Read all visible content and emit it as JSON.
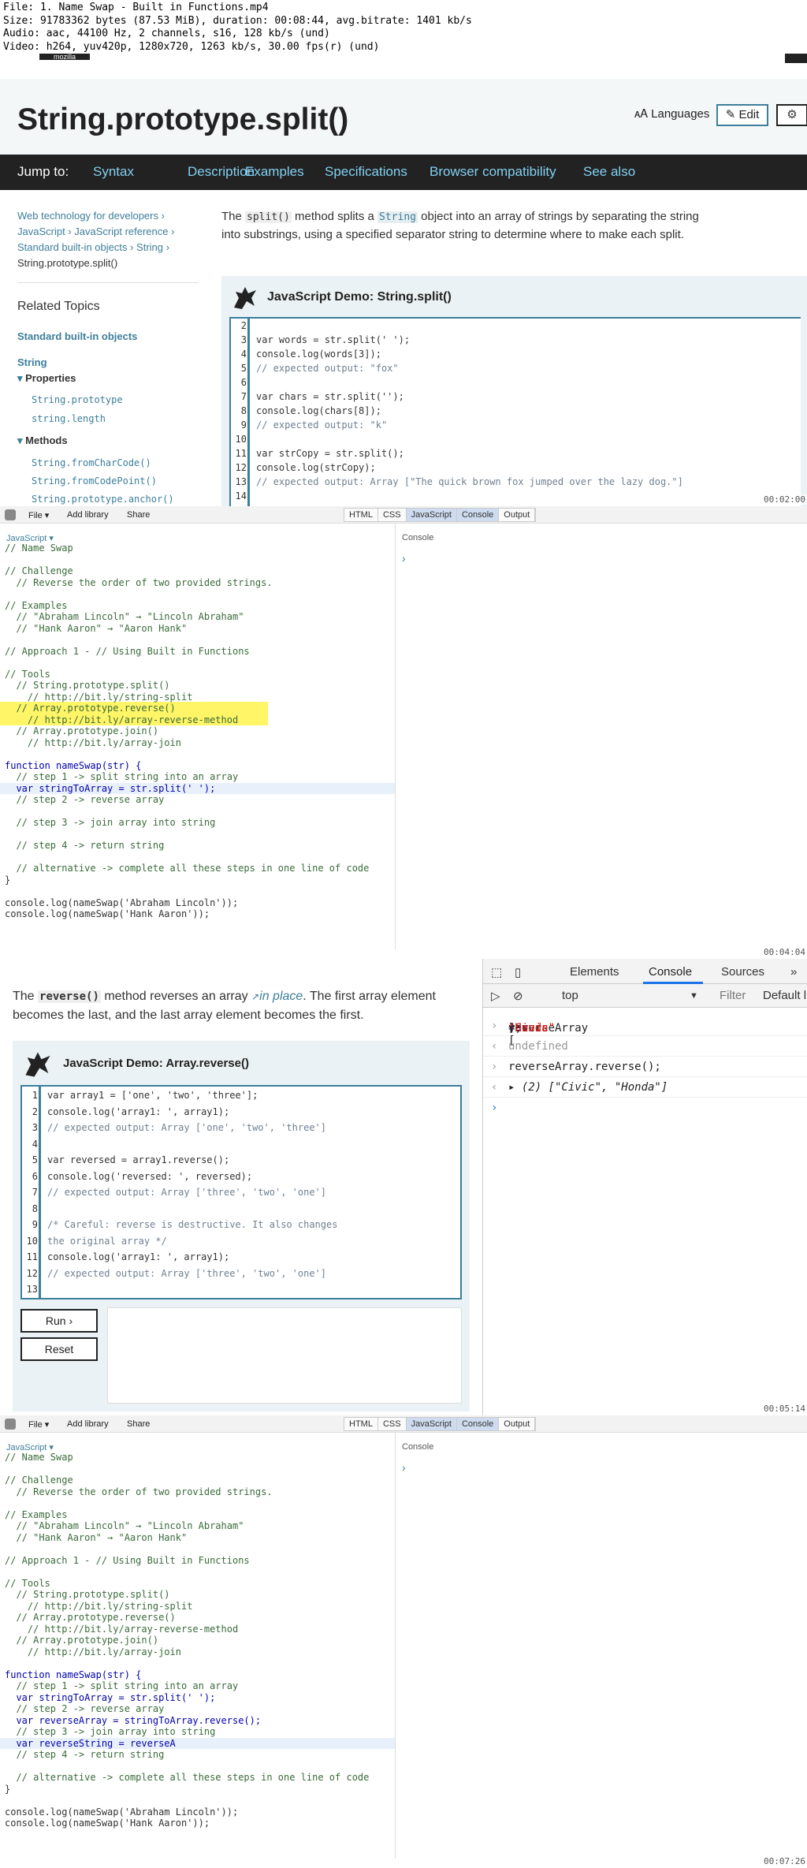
{
  "fileinfo": {
    "line1": "File: 1. Name Swap - Built in Functions.mp4",
    "line2": "Size: 91783362 bytes (87.53 MiB), duration: 00:08:44, avg.bitrate: 1401 kb/s",
    "line3": "Audio: aac, 44100 Hz, 2 channels, s16, 128 kb/s (und)",
    "line4": "Video: h264, yuv420p, 1280x720, 1263 kb/s, 30.00 fps(r) (und)"
  },
  "frame1": {
    "logo": "mozilla",
    "title": "String.prototype.split()",
    "languages": "Languages",
    "edit": "Edit",
    "gear": "⚙",
    "jump_to": "Jump to:",
    "jump_links": [
      "Syntax",
      "Description",
      "Examples",
      "Specifications",
      "Browser compatibility",
      "See also"
    ],
    "breadcrumbs": [
      "Web technology for developers ›",
      "JavaScript ›",
      "JavaScript reference ›",
      "Standard built-in objects ›",
      "String ›",
      "String.prototype.split()"
    ],
    "related_topics": "Related Topics",
    "std_objects": "Standard built-in objects",
    "string": "String",
    "properties": "Properties",
    "prop_items": [
      "String.prototype",
      "string.length"
    ],
    "methods": "Methods",
    "method_items": [
      "String.fromCharCode()",
      "String.fromCodePoint()",
      "String.prototype.anchor()"
    ],
    "intro_a": "The ",
    "intro_code": "split()",
    "intro_b": " method splits a ",
    "intro_link": "String",
    "intro_c": " object into an array of strings by separating the string into substrings, using a specified separator string to determine where to make each split.",
    "demo_title": "JavaScript Demo: String.split()",
    "line_numbers": [
      "2",
      "3",
      "4",
      "5",
      "6",
      "7",
      "8",
      "9",
      "10",
      "11",
      "12",
      "13",
      "14"
    ],
    "code_lines": [
      "",
      "var words = str.split(' ');",
      "console.log(words[3]);",
      "// expected output: \"fox\"",
      "",
      "var chars = str.split('');",
      "console.log(chars[8]);",
      "// expected output: \"k\"",
      "",
      "var strCopy = str.split();",
      "console.log(strCopy);",
      "// expected output: Array [\"The quick brown fox jumped over the lazy dog.\"]",
      ""
    ],
    "timestamp": "00:02:00"
  },
  "fiddle": {
    "file": "File ▾",
    "add_library": "Add library",
    "share": "Share",
    "tabs": [
      "HTML",
      "CSS",
      "JavaScript",
      "Console",
      "Output"
    ],
    "lang": "JavaScript ▾",
    "console": "Console",
    "prompt": "›"
  },
  "frame2": {
    "lines": [
      "// Name Swap",
      "",
      "// Challenge",
      "  // Reverse the order of two provided strings.",
      "",
      "// Examples",
      "  // \"Abraham Lincoln\" → \"Lincoln Abraham\"",
      "  // \"Hank Aaron\" → \"Aaron Hank\"",
      "",
      "// Approach 1 - // Using Built in Functions",
      "",
      "// Tools",
      "  // String.prototype.split()",
      "    // http://bit.ly/string-split",
      "  // Array.prototype.reverse()",
      "    // http://bit.ly/array-reverse-method",
      "  // Array.prototype.join()",
      "    // http://bit.ly/array-join",
      "",
      "function nameSwap(str) {",
      "  // step 1 -> split string into an array",
      "  var stringToArray = str.split(' ');",
      "  // step 2 -> reverse array",
      "",
      "  // step 3 -> join array into string",
      "",
      "  // step 4 -> return string",
      "",
      "  // alternative -> complete all these steps in one line of code",
      "}",
      "",
      "console.log(nameSwap('Abraham Lincoln'));",
      "console.log(nameSwap('Hank Aaron'));"
    ],
    "timestamp": "00:04:04"
  },
  "frame3": {
    "text_a": "The ",
    "text_code": "reverse()",
    "text_b": " method reverses an array ",
    "text_em": "in place",
    "text_c": ". The first array element becomes the last, and the last array element becomes the first.",
    "demo_title": "JavaScript Demo: Array.reverse()",
    "line_numbers": [
      "1",
      "2",
      "3",
      "4",
      "5",
      "6",
      "7",
      "8",
      "9",
      "10",
      "11",
      "12",
      "13"
    ],
    "code_lines": [
      "var array1 = ['one', 'two', 'three'];",
      "console.log('array1: ', array1);",
      "// expected output: Array ['one', 'two', 'three']",
      "",
      "var reversed = array1.reverse();",
      "console.log('reversed: ', reversed);",
      "// expected output: Array ['three', 'two', 'one']",
      "",
      "/* Careful: reverse is destructive. It also changes",
      "the original array */",
      "console.log('array1: ', array1);",
      "// expected output: Array ['three', 'two', 'one']",
      ""
    ],
    "run": "Run ›",
    "reset": "Reset",
    "dev_tabs": [
      "Elements",
      "Console",
      "Sources"
    ],
    "more": "»",
    "top": "top",
    "filter": "Filter",
    "default": "Default l",
    "c1_kw": "var",
    "c1_name": "reverseArray",
    "c1_eq": " = [",
    "c1_s1": "\"Honda\"",
    "c1_comma": ", ",
    "c1_s2": "\"Civic\"",
    "c1_end": "];",
    "c2": "undefined",
    "c3": "reverseArray.reverse();",
    "c4": "▸ (2) [\"Civic\", \"Honda\"]",
    "timestamp": "00:05:14"
  },
  "frame4": {
    "lines": [
      "// Name Swap",
      "",
      "// Challenge",
      "  // Reverse the order of two provided strings.",
      "",
      "// Examples",
      "  // \"Abraham Lincoln\" → \"Lincoln Abraham\"",
      "  // \"Hank Aaron\" → \"Aaron Hank\"",
      "",
      "// Approach 1 - // Using Built in Functions",
      "",
      "// Tools",
      "  // String.prototype.split()",
      "    // http://bit.ly/string-split",
      "  // Array.prototype.reverse()",
      "    // http://bit.ly/array-reverse-method",
      "  // Array.prototype.join()",
      "    // http://bit.ly/array-join",
      "",
      "function nameSwap(str) {",
      "  // step 1 -> split string into an array",
      "  var stringToArray = str.split(' ');",
      "  // step 2 -> reverse array",
      "  var reverseArray = stringToArray.reverse();",
      "  // step 3 -> join array into string",
      "  var reverseString = reverseA",
      "  // step 4 -> return string",
      "",
      "  // alternative -> complete all these steps in one line of code",
      "}",
      "",
      "console.log(nameSwap('Abraham Lincoln'));",
      "console.log(nameSwap('Hank Aaron'));"
    ],
    "timestamp": "00:07:26"
  }
}
